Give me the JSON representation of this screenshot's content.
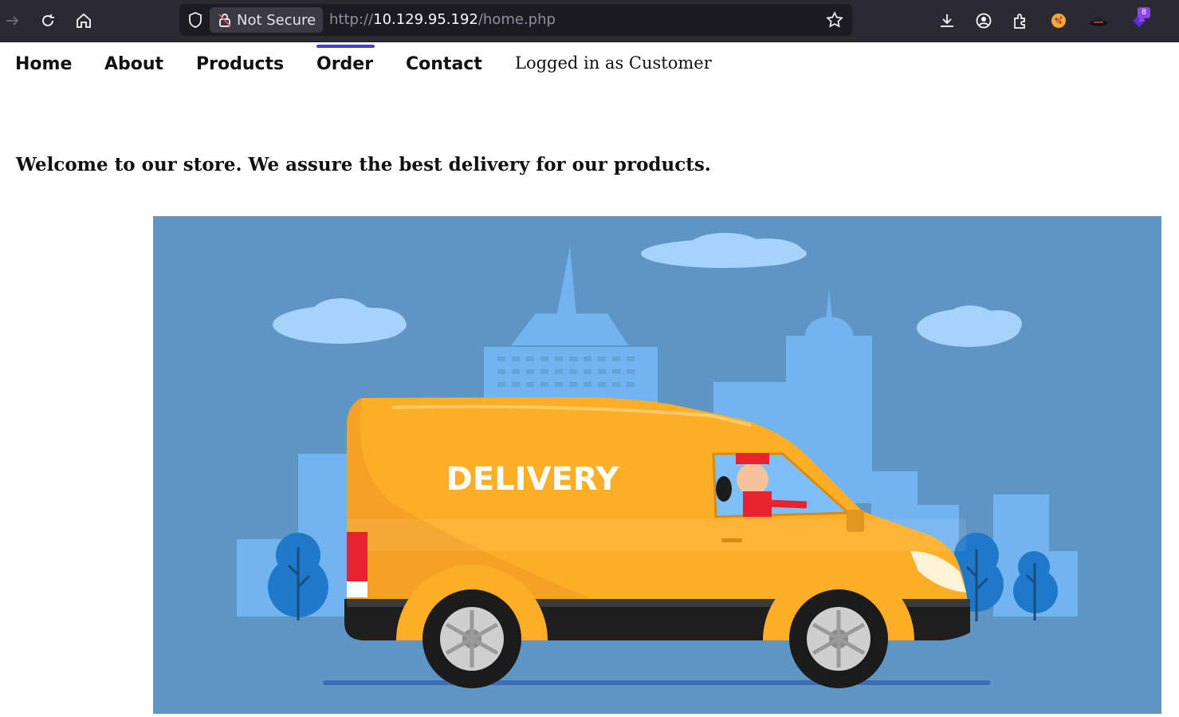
{
  "browser": {
    "security_label": "Not Secure",
    "url_scheme": "http://",
    "url_host": "10.129.95.192",
    "url_path": "/home.php",
    "extension_badge": "8"
  },
  "nav": {
    "items": [
      {
        "label": "Home"
      },
      {
        "label": "About"
      },
      {
        "label": "Products"
      },
      {
        "label": "Order"
      },
      {
        "label": "Contact"
      }
    ],
    "active": "Order",
    "status_text": "Logged in as Customer"
  },
  "main": {
    "welcome": "Welcome to our store. We assure the best delivery for our products.",
    "hero": {
      "van_text": "DELIVERY",
      "alt": "delivery van illustration"
    }
  },
  "colors": {
    "accent": "#4c3ad6",
    "sky": "#5f95c5",
    "van": "#fdae27"
  }
}
